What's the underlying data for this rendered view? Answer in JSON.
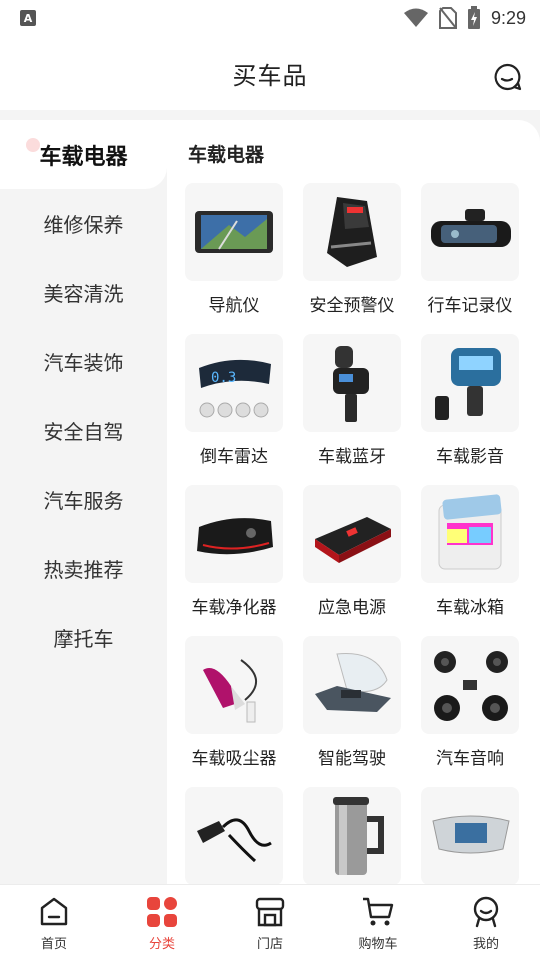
{
  "status_bar": {
    "time": "9:29",
    "notification_letter": "A"
  },
  "header": {
    "title": "买车品"
  },
  "sidebar": {
    "items": [
      {
        "label": "车载电器"
      },
      {
        "label": "维修保养"
      },
      {
        "label": "美容清洗"
      },
      {
        "label": "汽车装饰"
      },
      {
        "label": "安全自驾"
      },
      {
        "label": "汽车服务"
      },
      {
        "label": "热卖推荐"
      },
      {
        "label": "摩托车"
      }
    ],
    "active_index": 0
  },
  "main": {
    "section_title": "车载电器",
    "products": [
      {
        "label": "导航仪",
        "icon": "gps-navigator-image"
      },
      {
        "label": "安全预警仪",
        "icon": "radar-detector-image"
      },
      {
        "label": "行车记录仪",
        "icon": "mirror-dashcam-image"
      },
      {
        "label": "倒车雷达",
        "icon": "parking-sensor-image"
      },
      {
        "label": "车载蓝牙",
        "icon": "bluetooth-adapter-image"
      },
      {
        "label": "车载影音",
        "icon": "fm-transmitter-image"
      },
      {
        "label": "车载净化器",
        "icon": "air-purifier-image"
      },
      {
        "label": "应急电源",
        "icon": "jump-starter-image"
      },
      {
        "label": "车载冰箱",
        "icon": "car-fridge-image"
      },
      {
        "label": "车载吸尘器",
        "icon": "vacuum-cleaner-image"
      },
      {
        "label": "智能驾驶",
        "icon": "hud-display-image"
      },
      {
        "label": "汽车音响",
        "icon": "car-speakers-image"
      },
      {
        "label": "",
        "icon": "cigarette-charger-image"
      },
      {
        "label": "",
        "icon": "heated-mug-image"
      },
      {
        "label": "",
        "icon": "dashboard-screen-image"
      }
    ]
  },
  "bottom_nav": {
    "items": [
      {
        "label": "首页",
        "icon": "home-icon"
      },
      {
        "label": "分类",
        "icon": "category-icon"
      },
      {
        "label": "门店",
        "icon": "store-icon"
      },
      {
        "label": "购物车",
        "icon": "cart-icon"
      },
      {
        "label": "我的",
        "icon": "profile-icon"
      }
    ],
    "active_index": 1
  },
  "colors": {
    "accent": "#e8453c",
    "sidebar_bg": "#f4f4f4",
    "thumb_bg": "#f6f6f6"
  }
}
